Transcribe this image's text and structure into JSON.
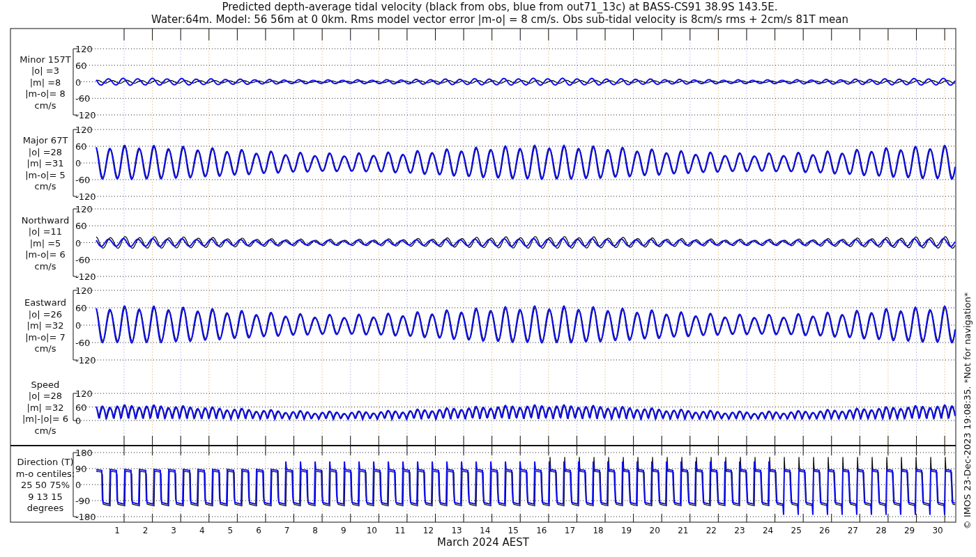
{
  "title_lines": [
    "Predicted depth-average tidal velocity (black from obs, blue from out71_13c) at BASS-CS91 38.9S 143.5E.",
    "Water:64m. Model: 56 56m at 0 0km. Rms model vector error |m-o| = 8 cm/s. Obs sub-tidal velocity is 8cm/s rms + 2cm/s 81T mean"
  ],
  "panels": [
    {
      "kind": "minor",
      "label_lines": [
        "Minor 157T",
        "|o| =3",
        "|m| =8",
        "|m-o|= 8",
        "cm/s"
      ],
      "yticks": [
        "120",
        "60",
        "0",
        "-60",
        "-120"
      ]
    },
    {
      "kind": "major",
      "label_lines": [
        "Major 67T",
        "|o| =28",
        "|m| =31",
        "|m-o|= 5",
        "cm/s"
      ],
      "yticks": [
        "120",
        "60",
        "0",
        "-60",
        "-120"
      ]
    },
    {
      "kind": "north",
      "label_lines": [
        "Northward",
        "|o| =11",
        "|m| =5",
        "|m-o|= 6",
        "cm/s"
      ],
      "yticks": [
        "120",
        "60",
        "0",
        "-60",
        "-120"
      ]
    },
    {
      "kind": "east",
      "label_lines": [
        "Eastward",
        "|o| =26",
        "|m| =32",
        "|m-o|= 7",
        "cm/s"
      ],
      "yticks": [
        "120",
        "60",
        "0",
        "-60",
        "-120"
      ]
    },
    {
      "kind": "speed",
      "label_lines": [
        "Speed",
        "|o| =28",
        "|m| =32",
        "|m|-|o|= 6",
        "cm/s"
      ],
      "yticks": [
        "120",
        "60",
        "0"
      ]
    },
    {
      "kind": "direction",
      "label_lines": [
        "Direction (T)",
        "m-o centiles:",
        "25  50  75%",
        "9  13  15",
        "degrees"
      ],
      "yticks": [
        "180",
        "90",
        "0",
        "-90",
        "-180"
      ]
    }
  ],
  "x_axis": {
    "days": [
      "1",
      "2",
      "3",
      "4",
      "5",
      "6",
      "7",
      "8",
      "9",
      "10",
      "11",
      "12",
      "13",
      "14",
      "15",
      "16",
      "17",
      "18",
      "19",
      "20",
      "21",
      "22",
      "23",
      "24",
      "25",
      "26",
      "27",
      "28",
      "29",
      "30"
    ],
    "xlabel": "March 2024 AEST"
  },
  "credit": "© IMOS 23-Dec-2023 19:08:35. *Not for navigation*"
}
